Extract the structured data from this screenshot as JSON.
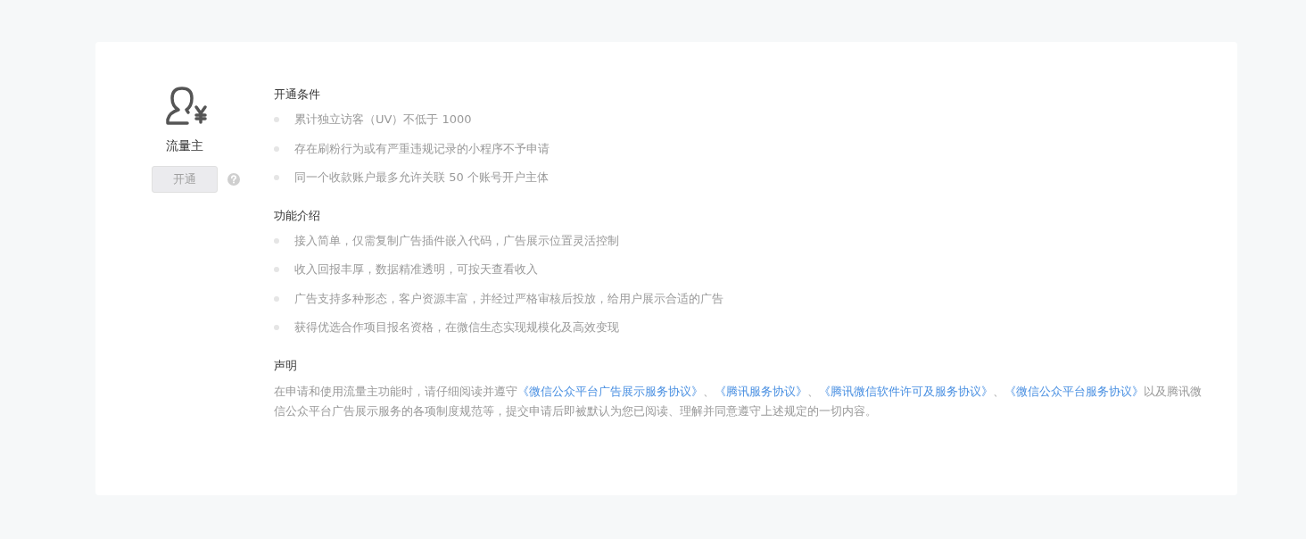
{
  "product": {
    "name": "流量主",
    "button": {
      "label": "开通",
      "disabled": true
    }
  },
  "sections": [
    {
      "title": "开通条件",
      "items": [
        "累计独立访客（UV）不低于 1000",
        "存在刷粉行为或有严重违规记录的小程序不予申请",
        "同一个收款账户最多允许关联 50 个账号开户主体"
      ]
    },
    {
      "title": "功能介绍",
      "items": [
        "接入简单，仅需复制广告插件嵌入代码，广告展示位置灵活控制",
        "收入回报丰厚，数据精准透明，可按天查看收入",
        "广告支持多种形态，客户资源丰富，并经过严格审核后投放，给用户展示合适的广告",
        "获得优选合作项目报名资格，在微信生态实现规模化及高效变现"
      ]
    }
  ],
  "statement": {
    "title": "声明",
    "parts": [
      {
        "kind": "text",
        "text": "在申请和使用流量主功能时，请仔细阅读并遵守"
      },
      {
        "kind": "link",
        "text": "《微信公众平台广告展示服务协议》"
      },
      {
        "kind": "text",
        "text": "、"
      },
      {
        "kind": "link",
        "text": "《腾讯服务协议》"
      },
      {
        "kind": "text",
        "text": "、"
      },
      {
        "kind": "link",
        "text": "《腾讯微信软件许可及服务协议》"
      },
      {
        "kind": "text",
        "text": "、"
      },
      {
        "kind": "link",
        "text": "《微信公众平台服务协议》"
      },
      {
        "kind": "text",
        "text": "以及腾讯微信公众平台广告展示服务的各项制度规范等，提交申请后即被默认为您已阅读、理解并同意遵守上述规定的一切内容。"
      }
    ]
  }
}
